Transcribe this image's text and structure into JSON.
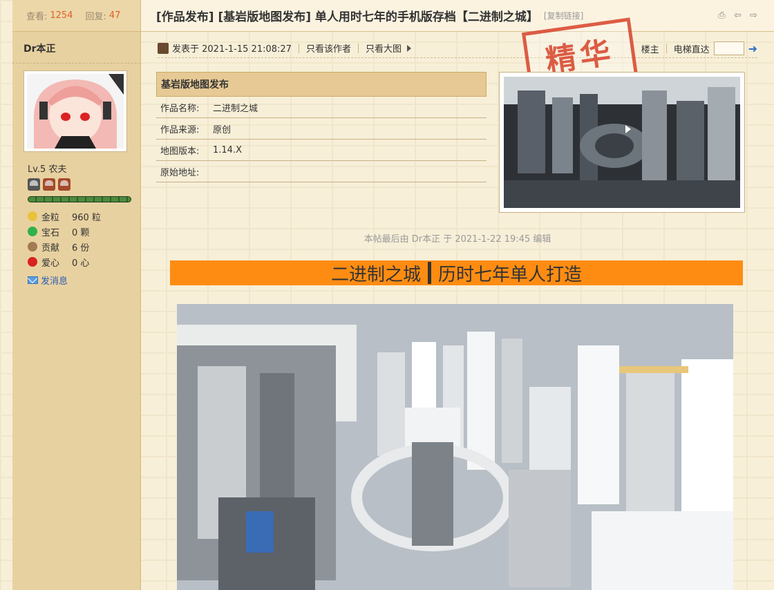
{
  "thread": {
    "title": "[作品发布] [基岩版地图发布] 单人用时七年的手机版存档【二进制之城】",
    "copy_link": "[复制链接]"
  },
  "stats": {
    "views_label": "查看:",
    "views": "1254",
    "replies_label": "回复:",
    "replies": "47"
  },
  "author": {
    "name": "Dr本正",
    "level": "Lv.5 农夫",
    "items": [
      {
        "label": "金粒",
        "value": "960 粒",
        "icon": "gold-nugget-icon",
        "color": "#e8c23a"
      },
      {
        "label": "宝石",
        "value": "0 颗",
        "icon": "emerald-icon",
        "color": "#2fb24a"
      },
      {
        "label": "贡献",
        "value": "6 份",
        "icon": "cookie-icon",
        "color": "#a27b55"
      },
      {
        "label": "爱心",
        "value": "0 心",
        "icon": "apple-icon",
        "color": "#d8231f"
      }
    ],
    "send_message": "发消息"
  },
  "post": {
    "posted_at": "发表于 2021-1-15 21:08:27",
    "only_author": "只看该作者",
    "only_big_image": "只看大图",
    "floor": "楼主",
    "elevator": "电梯直达",
    "stamp": "精华",
    "edited_note": "本帖最后由 Dr本正 于 2021-1-22 19:45 编辑"
  },
  "info": {
    "heading": "基岩版地图发布",
    "rows": [
      {
        "key": "作品名称:",
        "value": "二进制之城"
      },
      {
        "key": "作品来源:",
        "value": "原创"
      },
      {
        "key": "地图版本:",
        "value": "1.14.X"
      },
      {
        "key": "原始地址:",
        "value": ""
      }
    ]
  },
  "banner": {
    "left": "二进制之城",
    "right": "历时七年单人打造",
    "color": "#ff8c12"
  }
}
